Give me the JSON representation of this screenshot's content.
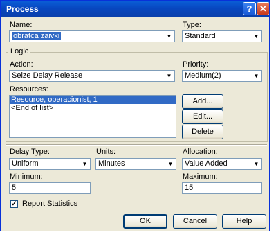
{
  "window": {
    "title": "Process",
    "help_label": "?",
    "close_label": "✕"
  },
  "name": {
    "label": "Name:",
    "value": "obratca zaivki"
  },
  "type": {
    "label": "Type:",
    "value": "Standard"
  },
  "logic": {
    "legend": "Logic"
  },
  "action": {
    "label": "Action:",
    "value": "Seize Delay Release"
  },
  "priority": {
    "label": "Priority:",
    "value": "Medium(2)"
  },
  "resources": {
    "label": "Resources:",
    "items": [
      "Resource, operacionist, 1",
      "<End of list>"
    ],
    "add_label": "Add...",
    "edit_label": "Edit...",
    "delete_label": "Delete"
  },
  "delay_type": {
    "label": "Delay Type:",
    "value": "Uniform"
  },
  "units": {
    "label": "Units:",
    "value": "Minutes"
  },
  "allocation": {
    "label": "Allocation:",
    "value": "Value Added"
  },
  "minimum": {
    "label": "Minimum:",
    "value": "5"
  },
  "maximum": {
    "label": "Maximum:",
    "value": "15"
  },
  "report_statistics": {
    "label": "Report Statistics",
    "checked": true,
    "check_glyph": "✓"
  },
  "buttons": {
    "ok": "OK",
    "cancel": "Cancel",
    "help": "Help"
  },
  "icons": {
    "dropdown_arrow": "▼"
  },
  "colors": {
    "titlebar": "#0a4ac8",
    "selection": "#316ac5",
    "face": "#ece9d8"
  }
}
